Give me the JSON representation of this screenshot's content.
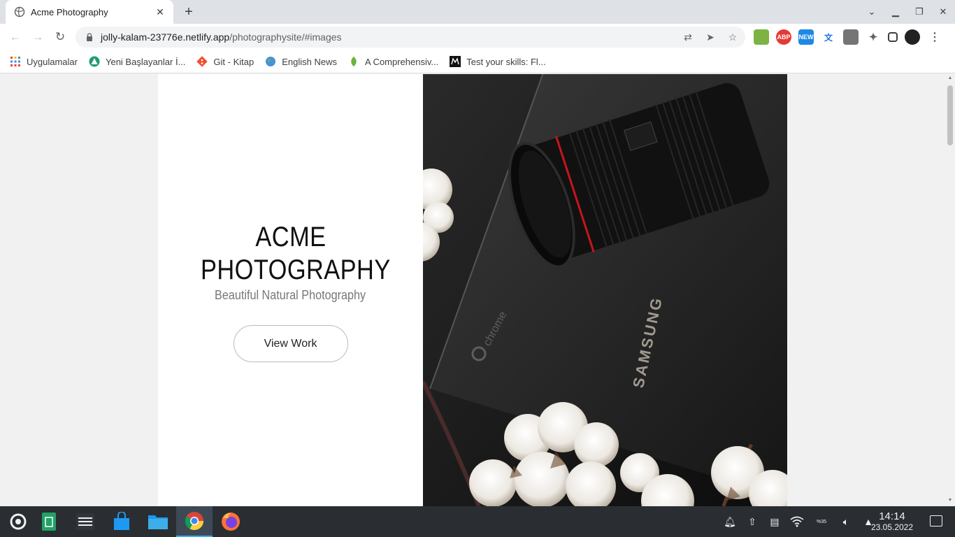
{
  "browser": {
    "tab_title": "Acme Photography",
    "tab_close": "✕",
    "new_tab": "+",
    "url_host": "jolly-kalam-23776e.netlify.app",
    "url_path": "/photographysite/#images"
  },
  "bookmarks": [
    {
      "label": "Uygulamalar",
      "icon": "apps-grid-icon"
    },
    {
      "label": "Yeni Başlayanlar İ...",
      "icon": "green-triangle-icon"
    },
    {
      "label": "Git - Kitap",
      "icon": "git-icon"
    },
    {
      "label": "English News",
      "icon": "globe-icon"
    },
    {
      "label": "A Comprehensiv...",
      "icon": "leaf-icon"
    },
    {
      "label": "Test your skills: Fl...",
      "icon": "mdn-icon"
    }
  ],
  "page": {
    "brand_line1": "ACME",
    "brand_line2": "PHOTOGRAPHY",
    "tagline": "Beautiful Natural Photography",
    "cta_label": "View Work",
    "hero_image_text_brand": "SAMSUNG",
    "hero_image_text_chrome": "chrome"
  },
  "taskbar": {
    "time": "14:14",
    "date": "23.05.2022",
    "battery_label": "%35"
  },
  "colors": {
    "accent": "#3daee9",
    "tab_bg": "#dee1e6",
    "taskbar_bg": "#2a2e32"
  }
}
